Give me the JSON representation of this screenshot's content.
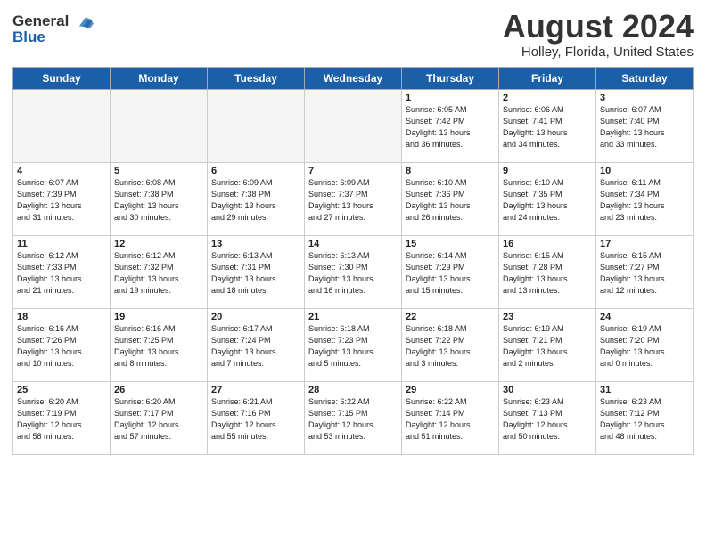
{
  "header": {
    "logo_line1": "General",
    "logo_line2": "Blue",
    "month_title": "August 2024",
    "location": "Holley, Florida, United States"
  },
  "weekdays": [
    "Sunday",
    "Monday",
    "Tuesday",
    "Wednesday",
    "Thursday",
    "Friday",
    "Saturday"
  ],
  "weeks": [
    [
      {
        "day": "",
        "info": ""
      },
      {
        "day": "",
        "info": ""
      },
      {
        "day": "",
        "info": ""
      },
      {
        "day": "",
        "info": ""
      },
      {
        "day": "1",
        "info": "Sunrise: 6:05 AM\nSunset: 7:42 PM\nDaylight: 13 hours\nand 36 minutes."
      },
      {
        "day": "2",
        "info": "Sunrise: 6:06 AM\nSunset: 7:41 PM\nDaylight: 13 hours\nand 34 minutes."
      },
      {
        "day": "3",
        "info": "Sunrise: 6:07 AM\nSunset: 7:40 PM\nDaylight: 13 hours\nand 33 minutes."
      }
    ],
    [
      {
        "day": "4",
        "info": "Sunrise: 6:07 AM\nSunset: 7:39 PM\nDaylight: 13 hours\nand 31 minutes."
      },
      {
        "day": "5",
        "info": "Sunrise: 6:08 AM\nSunset: 7:38 PM\nDaylight: 13 hours\nand 30 minutes."
      },
      {
        "day": "6",
        "info": "Sunrise: 6:09 AM\nSunset: 7:38 PM\nDaylight: 13 hours\nand 29 minutes."
      },
      {
        "day": "7",
        "info": "Sunrise: 6:09 AM\nSunset: 7:37 PM\nDaylight: 13 hours\nand 27 minutes."
      },
      {
        "day": "8",
        "info": "Sunrise: 6:10 AM\nSunset: 7:36 PM\nDaylight: 13 hours\nand 26 minutes."
      },
      {
        "day": "9",
        "info": "Sunrise: 6:10 AM\nSunset: 7:35 PM\nDaylight: 13 hours\nand 24 minutes."
      },
      {
        "day": "10",
        "info": "Sunrise: 6:11 AM\nSunset: 7:34 PM\nDaylight: 13 hours\nand 23 minutes."
      }
    ],
    [
      {
        "day": "11",
        "info": "Sunrise: 6:12 AM\nSunset: 7:33 PM\nDaylight: 13 hours\nand 21 minutes."
      },
      {
        "day": "12",
        "info": "Sunrise: 6:12 AM\nSunset: 7:32 PM\nDaylight: 13 hours\nand 19 minutes."
      },
      {
        "day": "13",
        "info": "Sunrise: 6:13 AM\nSunset: 7:31 PM\nDaylight: 13 hours\nand 18 minutes."
      },
      {
        "day": "14",
        "info": "Sunrise: 6:13 AM\nSunset: 7:30 PM\nDaylight: 13 hours\nand 16 minutes."
      },
      {
        "day": "15",
        "info": "Sunrise: 6:14 AM\nSunset: 7:29 PM\nDaylight: 13 hours\nand 15 minutes."
      },
      {
        "day": "16",
        "info": "Sunrise: 6:15 AM\nSunset: 7:28 PM\nDaylight: 13 hours\nand 13 minutes."
      },
      {
        "day": "17",
        "info": "Sunrise: 6:15 AM\nSunset: 7:27 PM\nDaylight: 13 hours\nand 12 minutes."
      }
    ],
    [
      {
        "day": "18",
        "info": "Sunrise: 6:16 AM\nSunset: 7:26 PM\nDaylight: 13 hours\nand 10 minutes."
      },
      {
        "day": "19",
        "info": "Sunrise: 6:16 AM\nSunset: 7:25 PM\nDaylight: 13 hours\nand 8 minutes."
      },
      {
        "day": "20",
        "info": "Sunrise: 6:17 AM\nSunset: 7:24 PM\nDaylight: 13 hours\nand 7 minutes."
      },
      {
        "day": "21",
        "info": "Sunrise: 6:18 AM\nSunset: 7:23 PM\nDaylight: 13 hours\nand 5 minutes."
      },
      {
        "day": "22",
        "info": "Sunrise: 6:18 AM\nSunset: 7:22 PM\nDaylight: 13 hours\nand 3 minutes."
      },
      {
        "day": "23",
        "info": "Sunrise: 6:19 AM\nSunset: 7:21 PM\nDaylight: 13 hours\nand 2 minutes."
      },
      {
        "day": "24",
        "info": "Sunrise: 6:19 AM\nSunset: 7:20 PM\nDaylight: 13 hours\nand 0 minutes."
      }
    ],
    [
      {
        "day": "25",
        "info": "Sunrise: 6:20 AM\nSunset: 7:19 PM\nDaylight: 12 hours\nand 58 minutes."
      },
      {
        "day": "26",
        "info": "Sunrise: 6:20 AM\nSunset: 7:17 PM\nDaylight: 12 hours\nand 57 minutes."
      },
      {
        "day": "27",
        "info": "Sunrise: 6:21 AM\nSunset: 7:16 PM\nDaylight: 12 hours\nand 55 minutes."
      },
      {
        "day": "28",
        "info": "Sunrise: 6:22 AM\nSunset: 7:15 PM\nDaylight: 12 hours\nand 53 minutes."
      },
      {
        "day": "29",
        "info": "Sunrise: 6:22 AM\nSunset: 7:14 PM\nDaylight: 12 hours\nand 51 minutes."
      },
      {
        "day": "30",
        "info": "Sunrise: 6:23 AM\nSunset: 7:13 PM\nDaylight: 12 hours\nand 50 minutes."
      },
      {
        "day": "31",
        "info": "Sunrise: 6:23 AM\nSunset: 7:12 PM\nDaylight: 12 hours\nand 48 minutes."
      }
    ]
  ]
}
